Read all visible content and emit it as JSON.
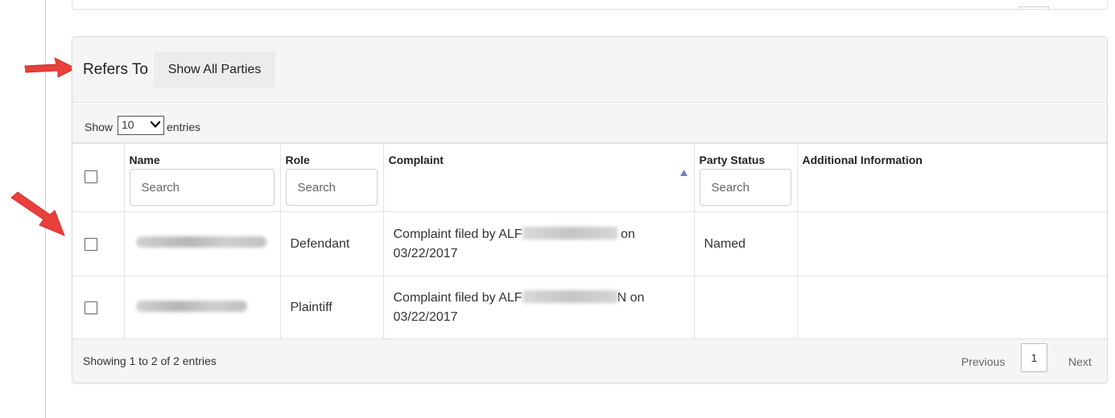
{
  "refers_to": {
    "title": "Refers To",
    "show_all_button": "Show All Parties"
  },
  "length_menu": {
    "show_label": "Show",
    "selected": "10",
    "entries_label": "entries"
  },
  "columns": [
    {
      "label": "Name",
      "search_placeholder": "Search"
    },
    {
      "label": "Role",
      "search_placeholder": "Search"
    },
    {
      "label": "Complaint",
      "sorted": "ascending"
    },
    {
      "label": "Party Status",
      "search_placeholder": "Search"
    },
    {
      "label": "Additional Information"
    }
  ],
  "rows": [
    {
      "role": "Defendant",
      "complaint_prefix": "Complaint filed by ALF",
      "complaint_suffix": " on",
      "complaint_date": "03/22/2017",
      "party_status": "Named",
      "additional_information": ""
    },
    {
      "role": "Plaintiff",
      "complaint_prefix": "Complaint filed by ALF",
      "complaint_suffix": "N on",
      "complaint_date": "03/22/2017",
      "party_status": "",
      "additional_information": ""
    }
  ],
  "footer": {
    "info": "Showing 1 to 2 of 2 entries",
    "previous": "Previous",
    "page": "1",
    "next": "Next"
  },
  "colors": {
    "annotation_arrow": "#e8403a",
    "sort_indicator": "#6f7fcf"
  },
  "icons": {
    "annotation": "red-arrow-icon",
    "select": "chevron-down-icon",
    "sort": "sort-ascending-icon"
  }
}
